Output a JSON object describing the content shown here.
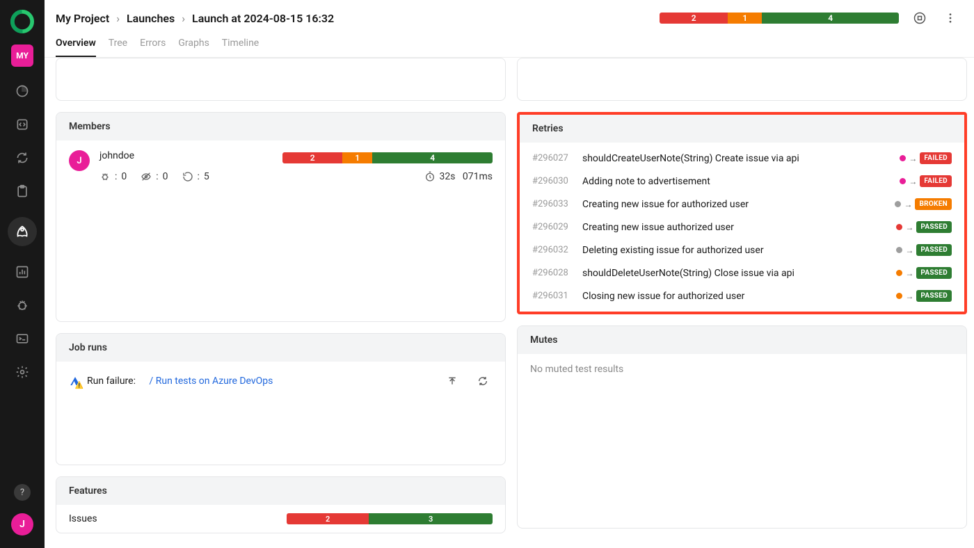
{
  "sidebar": {
    "project_badge": "MY",
    "user_initial": "J"
  },
  "breadcrumb": {
    "project": "My Project",
    "section": "Launches",
    "title": "Launch at 2024-08-15 16:32"
  },
  "header_status": {
    "red": "2",
    "orange": "1",
    "green": "4"
  },
  "tabs": [
    {
      "label": "Overview",
      "active": true
    },
    {
      "label": "Tree",
      "active": false
    },
    {
      "label": "Errors",
      "active": false
    },
    {
      "label": "Graphs",
      "active": false
    },
    {
      "label": "Timeline",
      "active": false
    }
  ],
  "members": {
    "title": "Members",
    "user": {
      "initial": "J",
      "name": "johndoe"
    },
    "bar": {
      "red": "2",
      "orange": "1",
      "green": "4"
    },
    "metrics": {
      "bugs": "0",
      "hidden": "0",
      "retries": "5",
      "time": "32s   071ms"
    }
  },
  "jobruns": {
    "title": "Job runs",
    "label": "Run failure:",
    "link": "/ Run tests on Azure DevOps"
  },
  "features": {
    "title": "Features",
    "row_label": "Issues",
    "bar": {
      "red": "2",
      "green": "3"
    }
  },
  "retries": {
    "title": "Retries",
    "items": [
      {
        "id": "#296027",
        "title": "shouldCreateUserNote(String) Create issue via api",
        "dot": "pink",
        "status": "FAILED",
        "badge": "failed"
      },
      {
        "id": "#296030",
        "title": "Adding note to advertisement",
        "dot": "pink",
        "status": "FAILED",
        "badge": "failed"
      },
      {
        "id": "#296033",
        "title": "Creating new issue for authorized user",
        "dot": "grey",
        "status": "BROKEN",
        "badge": "broken"
      },
      {
        "id": "#296029",
        "title": "Creating new issue authorized user",
        "dot": "red",
        "status": "PASSED",
        "badge": "passed"
      },
      {
        "id": "#296032",
        "title": "Deleting existing issue for authorized user",
        "dot": "grey",
        "status": "PASSED",
        "badge": "passed"
      },
      {
        "id": "#296028",
        "title": "shouldDeleteUserNote(String) Close issue via api",
        "dot": "orange",
        "status": "PASSED",
        "badge": "passed"
      },
      {
        "id": "#296031",
        "title": "Closing new issue for authorized user",
        "dot": "orange",
        "status": "PASSED",
        "badge": "passed"
      }
    ]
  },
  "mutes": {
    "title": "Mutes",
    "empty": "No muted test results"
  }
}
